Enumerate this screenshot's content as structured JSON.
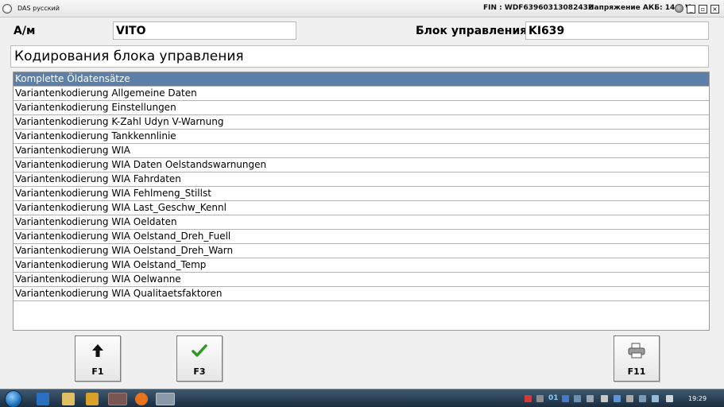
{
  "titlebar": {
    "app_title": "DAS русский",
    "fin": "FIN : WDF63960313082432",
    "voltage": "Напряжение АКБ: 14.2 V",
    "minimize": "_",
    "restore": "▫",
    "close": "×"
  },
  "header": {
    "vehicle_label": "А/м",
    "vehicle_value": "VITO",
    "ecu_label": "Блок управления",
    "ecu_value": "KI639"
  },
  "section_title": "Кодирования блока управления",
  "list": {
    "items": [
      "Komplette Öldatensätze",
      "Variantenkodierung Allgemeine Daten",
      "Variantenkodierung Einstellungen",
      "Variantenkodierung K-Zahl Udyn V-Warnung",
      "Variantenkodierung Tankkennlinie",
      "Variantenkodierung WIA",
      "Variantenkodierung WIA Daten Oelstandswarnungen",
      "Variantenkodierung WIA Fahrdaten",
      "Variantenkodierung WIA Fehlmeng_Stillst",
      "Variantenkodierung WIA Last_Geschw_Kennl",
      "Variantenkodierung WIA Oeldaten",
      "Variantenkodierung WIA Oelstand_Dreh_Fuell",
      "Variantenkodierung WIA Oelstand_Dreh_Warn",
      "Variantenkodierung WIA Oelstand_Temp",
      "Variantenkodierung WIA Oelwanne",
      "Variantenkodierung WIA Qualitaetsfaktoren"
    ],
    "selected_index": 0
  },
  "buttons": {
    "f1": {
      "key": "F1",
      "icon": "up-arrow-icon"
    },
    "f3": {
      "key": "F3",
      "icon": "checkmark-icon"
    },
    "f11": {
      "key": "F11",
      "icon": "printer-icon"
    }
  },
  "taskbar": {
    "clock": "19:29",
    "lang_indicator": "01"
  },
  "colors": {
    "selected_row": "#5b7fa6",
    "checkmark": "#2e9a24"
  }
}
